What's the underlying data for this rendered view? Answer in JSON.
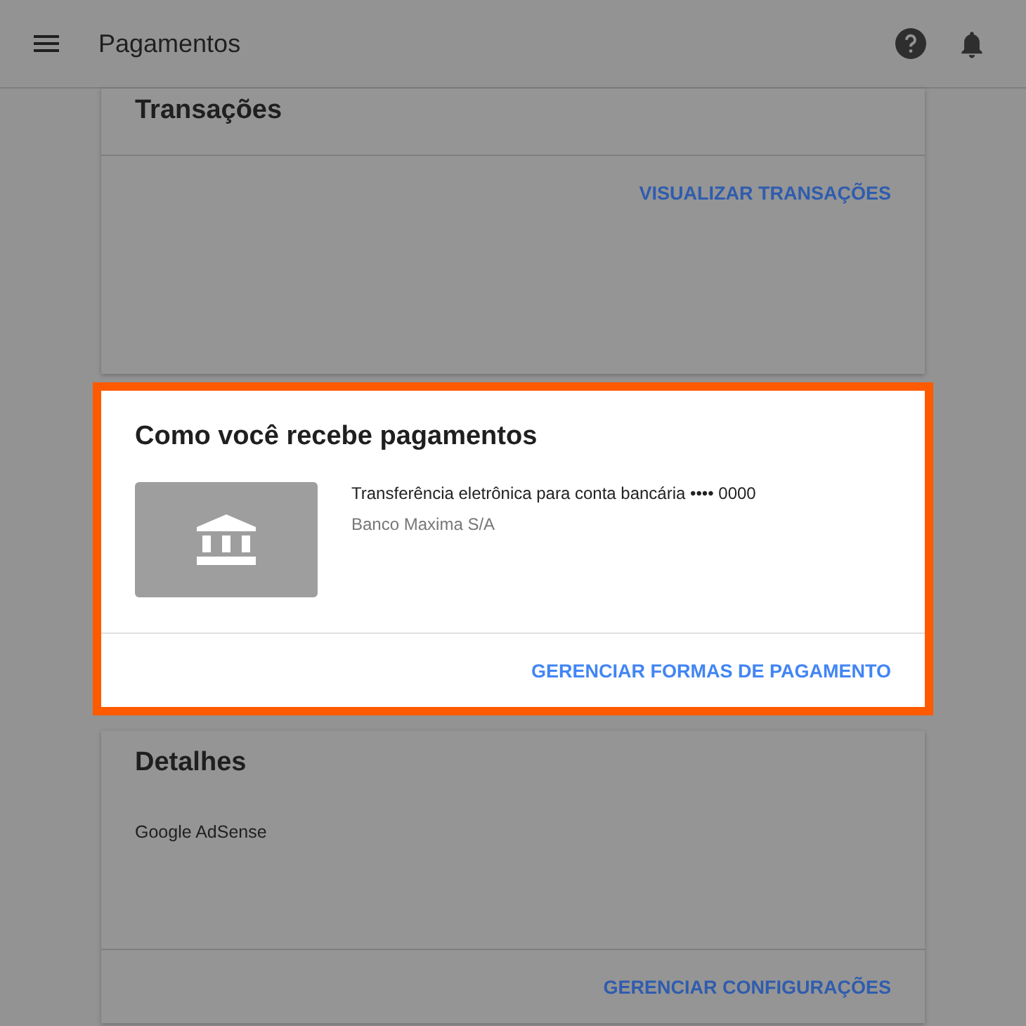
{
  "app_bar": {
    "title": "Pagamentos"
  },
  "cards": [
    {
      "kind": "link_only",
      "title": "Transações",
      "highlighted": false,
      "action": "VISUALIZAR TRANSAÇÕES"
    },
    {
      "kind": "payment_method",
      "title": "Como você recebe pagamentos",
      "highlighted": true,
      "method": {
        "description": "Transferência eletrônica para conta bancária •••• 0000",
        "bank": "Banco Maxima S/A"
      },
      "action": "GERENCIAR FORMAS DE PAGAMENTO"
    },
    {
      "kind": "details",
      "title": "Detalhes",
      "highlighted": false,
      "text": "Google AdSense",
      "action": "GERENCIAR CONFIGURAÇÕES"
    }
  ]
}
